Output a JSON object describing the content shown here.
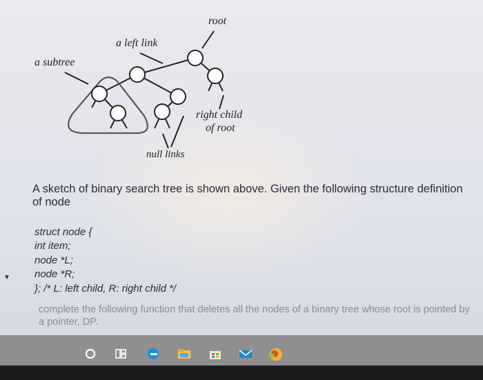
{
  "diagram": {
    "root_label": "root",
    "left_link_label": "a left link",
    "subtree_label": "a subtree",
    "right_child_label_line1": "right child",
    "right_child_label_line2": "of root",
    "null_links_label": "null links"
  },
  "question": {
    "intro": "A sketch of binary search tree is shown above. Given the following structure definition of node",
    "code_lines": [
      "struct node {",
      "int item;",
      "node *L;",
      "node *R;",
      "};   /* L: left child, R: right child */"
    ],
    "task": "complete the following function that deletes all the nodes of a binary tree whose root is pointed by a pointer, DP."
  },
  "taskbar": {
    "icons": [
      "cortana-icon",
      "task-view-icon",
      "edge-icon",
      "file-explorer-icon",
      "store-icon",
      "mail-icon",
      "app-icon"
    ]
  }
}
